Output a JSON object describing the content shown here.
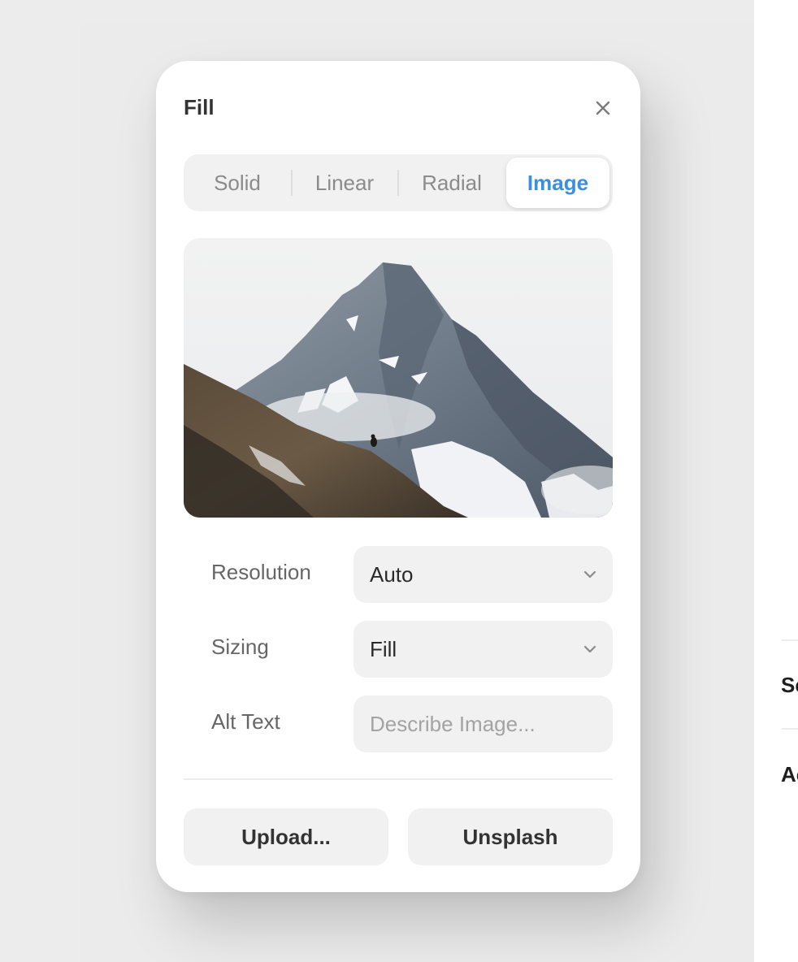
{
  "popover": {
    "title": "Fill",
    "tabs": [
      {
        "label": "Solid",
        "selected": false
      },
      {
        "label": "Linear",
        "selected": false
      },
      {
        "label": "Radial",
        "selected": false
      },
      {
        "label": "Image",
        "selected": true
      }
    ],
    "image_preview": {
      "description_icon": "mountain-photo"
    },
    "fields": {
      "resolution": {
        "label": "Resolution",
        "value": "Auto"
      },
      "sizing": {
        "label": "Sizing",
        "value": "Fill"
      },
      "alt_text": {
        "label": "Alt Text",
        "value": "",
        "placeholder": "Describe Image..."
      }
    },
    "buttons": {
      "upload": "Upload...",
      "unsplash": "Unsplash"
    }
  },
  "right_panel": {
    "items": [
      "Sc",
      "Ac"
    ]
  },
  "colors": {
    "accent": "#3b8fe0",
    "field_bg": "#f1f1f1",
    "canvas_bg": "#ebebeb"
  }
}
